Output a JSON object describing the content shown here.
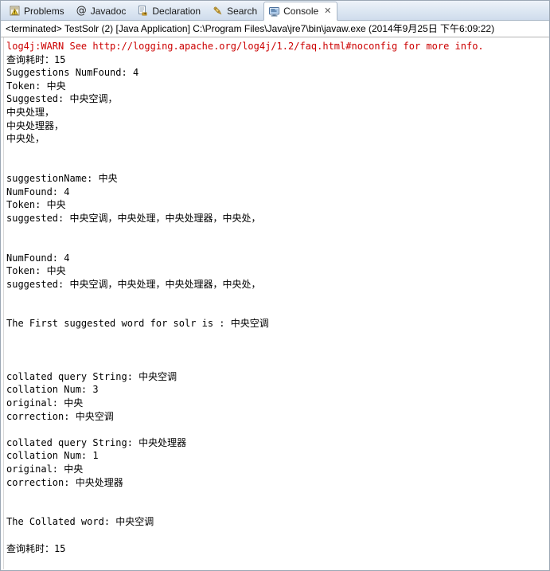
{
  "window": {
    "title": "Eclipse Console View"
  },
  "tabs": [
    {
      "label": "Problems",
      "icon": "problems-icon",
      "active": false,
      "closeable": false
    },
    {
      "label": "Javadoc",
      "icon": "javadoc-at-icon",
      "active": false,
      "closeable": false
    },
    {
      "label": "Declaration",
      "icon": "declaration-icon",
      "active": false,
      "closeable": false
    },
    {
      "label": "Search",
      "icon": "search-icon",
      "active": false,
      "closeable": false
    },
    {
      "label": "Console",
      "icon": "console-icon",
      "active": true,
      "closeable": true
    }
  ],
  "tab_close_glyph": "✕",
  "launch": {
    "status": "<terminated>",
    "config_name": "TestSolr (2)",
    "type": "[Java Application]",
    "command": "C:\\Program Files\\Java\\jre7\\bin\\javaw.exe",
    "timestamp": "(2014年9月25日 下午6:09:22)",
    "full_line": "<terminated> TestSolr (2) [Java Application] C:\\Program Files\\Java\\jre7\\bin\\javaw.exe (2014年9月25日 下午6:09:22)"
  },
  "colors": {
    "error_text": "#cc0000",
    "normal_text": "#000000",
    "tab_bar_bg": "#dce6f2",
    "active_tab_bg": "#ffffff",
    "border": "#a8b6c6"
  },
  "console_output": [
    {
      "text": "log4j:WARN See http://logging.apache.org/log4j/1.2/faq.html#noconfig for more info.",
      "style": "warn"
    },
    {
      "text": "查询耗时：15",
      "style": "normal"
    },
    {
      "text": "Suggestions NumFound: 4",
      "style": "normal"
    },
    {
      "text": "Token: 中央",
      "style": "normal"
    },
    {
      "text": "Suggested: 中央空调，",
      "style": "normal"
    },
    {
      "text": "中央处理，",
      "style": "normal"
    },
    {
      "text": "中央处理器，",
      "style": "normal"
    },
    {
      "text": "中央处，",
      "style": "normal"
    },
    {
      "text": "",
      "style": "normal"
    },
    {
      "text": "",
      "style": "normal"
    },
    {
      "text": "suggestionName: 中央",
      "style": "normal"
    },
    {
      "text": "NumFound: 4",
      "style": "normal"
    },
    {
      "text": "Token: 中央",
      "style": "normal"
    },
    {
      "text": "suggested: 中央空调，中央处理，中央处理器，中央处，",
      "style": "normal"
    },
    {
      "text": "",
      "style": "normal"
    },
    {
      "text": "",
      "style": "normal"
    },
    {
      "text": "NumFound: 4",
      "style": "normal"
    },
    {
      "text": "Token: 中央",
      "style": "normal"
    },
    {
      "text": "suggested: 中央空调，中央处理，中央处理器，中央处，",
      "style": "normal"
    },
    {
      "text": "",
      "style": "normal"
    },
    {
      "text": "",
      "style": "normal"
    },
    {
      "text": "The First suggested word for solr is : 中央空调",
      "style": "normal"
    },
    {
      "text": "",
      "style": "normal"
    },
    {
      "text": "",
      "style": "normal"
    },
    {
      "text": "",
      "style": "normal"
    },
    {
      "text": "collated query String: 中央空调",
      "style": "normal"
    },
    {
      "text": "collation Num: 3",
      "style": "normal"
    },
    {
      "text": "original: 中央",
      "style": "normal"
    },
    {
      "text": "correction: 中央空调",
      "style": "normal"
    },
    {
      "text": "",
      "style": "normal"
    },
    {
      "text": "collated query String: 中央处理器",
      "style": "normal"
    },
    {
      "text": "collation Num: 1",
      "style": "normal"
    },
    {
      "text": "original: 中央",
      "style": "normal"
    },
    {
      "text": "correction: 中央处理器",
      "style": "normal"
    },
    {
      "text": "",
      "style": "normal"
    },
    {
      "text": "",
      "style": "normal"
    },
    {
      "text": "The Collated word: 中央空调",
      "style": "normal"
    },
    {
      "text": "",
      "style": "normal"
    },
    {
      "text": "查询耗时：15",
      "style": "normal"
    }
  ]
}
